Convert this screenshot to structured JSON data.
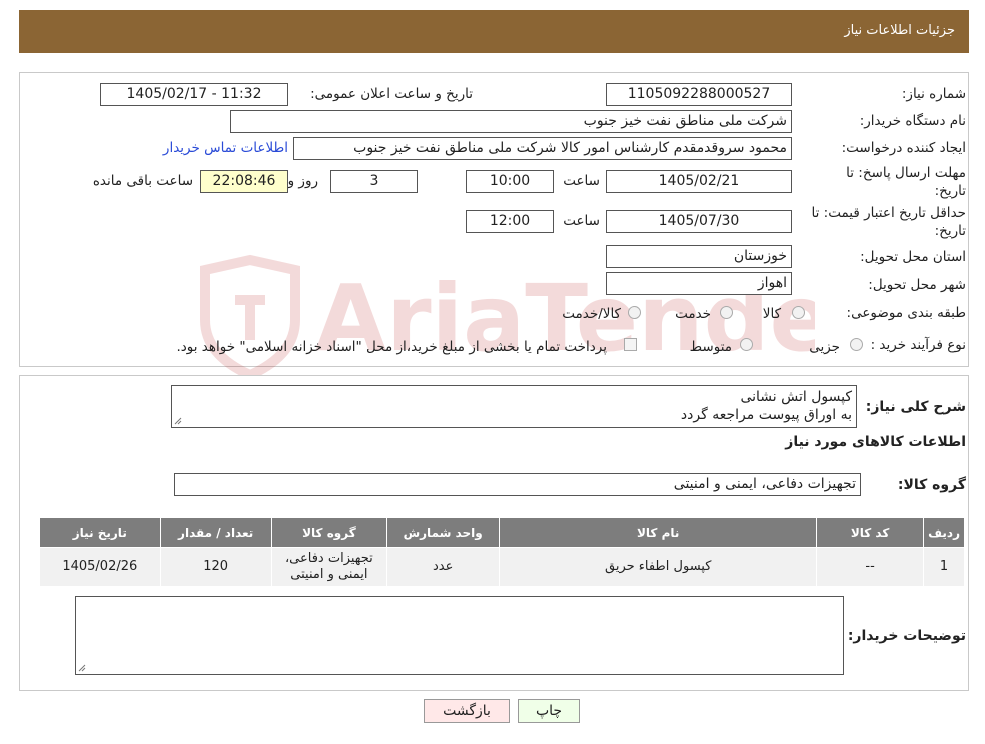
{
  "header": {
    "title": "جزئیات اطلاعات نیاز"
  },
  "form": {
    "need_number_label": "شماره نیاز:",
    "need_number": "1105092288000527",
    "announce_label": "تاریخ و ساعت اعلان عمومی:",
    "announce_value": "1405/02/17 - 11:32",
    "buyer_org_label": "نام دستگاه خریدار:",
    "buyer_org": "شرکت ملی مناطق نفت خیز جنوب",
    "creator_label": "ایجاد کننده درخواست:",
    "creator": "محمود سروقدمقدم کارشناس امور کالا شرکت ملی مناطق نفت خیز جنوب",
    "contact_link": "اطلاعات تماس خریدار",
    "deadline_label": "مهلت ارسال پاسخ: تا",
    "deadline_label2": "تاریخ:",
    "deadline_date": "1405/02/21",
    "time_label": "ساعت",
    "deadline_time": "10:00",
    "days_value": "3",
    "days_label": "روز و",
    "remaining_time": "22:08:46",
    "remaining_label": "ساعت باقی مانده",
    "validity_label": "حداقل تاریخ اعتبار قیمت: تا",
    "validity_label2": "تاریخ:",
    "validity_date": "1405/07/30",
    "validity_time": "12:00",
    "province_label": "استان محل تحویل:",
    "province": "خوزستان",
    "city_label": "شهر محل تحویل:",
    "city": "اهواز",
    "category_label": "طبقه بندی موضوعی:",
    "cat_options": [
      "کالا",
      "خدمت",
      "کالا/خدمت"
    ],
    "process_label": "نوع فرآیند خرید :",
    "process_options": [
      "جزیی",
      "متوسط"
    ],
    "process_note": "پرداخت تمام یا بخشی از مبلغ خرید،از محل \"اسناد خزانه اسلامی\" خواهد بود."
  },
  "details": {
    "general_desc_label": "شرح کلی نیاز:",
    "general_desc_line1": "کپسول اتش نشانی",
    "general_desc_line2": "به اوراق پیوست مراجعه گردد",
    "goods_info_title": "اطلاعات کالاهای مورد نیاز",
    "goods_group_label": "گروه کالا:",
    "goods_group": "تجهیزات دفاعی، ایمنی و امنیتی",
    "table": {
      "headers": [
        "ردیف",
        "کد کالا",
        "نام کالا",
        "واحد شمارش",
        "گروه کالا",
        "تعداد / مقدار",
        "تاریخ نیاز"
      ],
      "rows": [
        [
          "1",
          "--",
          "کپسول اطفاء حریق",
          "عدد",
          "تجهیزات دفاعی، ایمنی و امنیتی",
          "120",
          "1405/02/26"
        ]
      ]
    },
    "buyer_notes_label": "توضیحات خریدار:",
    "buyer_notes": ""
  },
  "buttons": {
    "print": "چاپ",
    "back": "بازگشت"
  },
  "watermark_text": "AriaTender.neT"
}
